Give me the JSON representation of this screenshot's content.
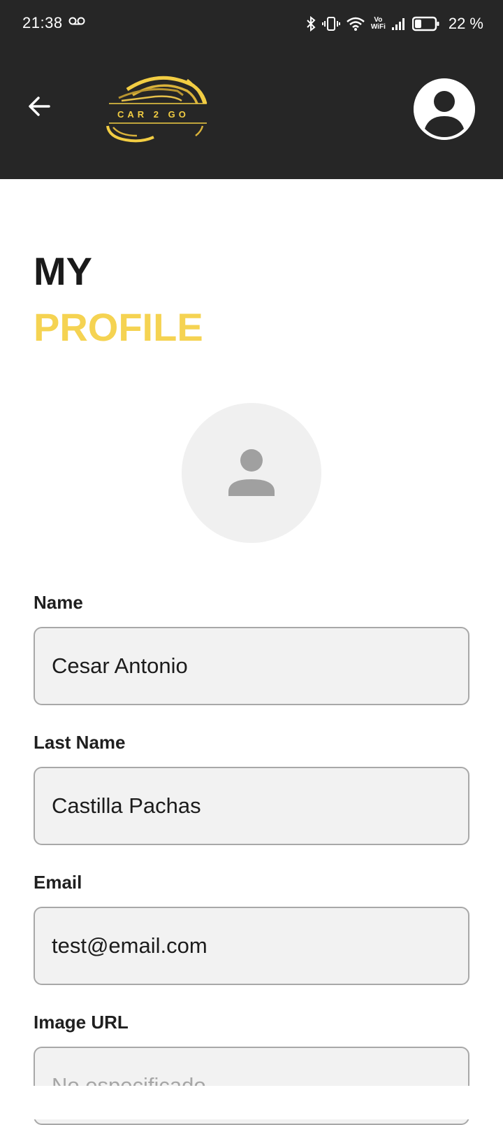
{
  "status_bar": {
    "time": "21:38",
    "vowifi_top": "Vo",
    "vowifi_bottom": "WiFi",
    "battery": "22 %"
  },
  "header": {
    "logo_text": "CAR 2 GO",
    "accent_color": "#f5d352",
    "bar_color": "#262626"
  },
  "page": {
    "title_line1": "MY",
    "title_line2": "PROFILE"
  },
  "form": {
    "fields": [
      {
        "label": "Name",
        "value": "Cesar Antonio",
        "placeholder": ""
      },
      {
        "label": "Last Name",
        "value": "Castilla Pachas",
        "placeholder": ""
      },
      {
        "label": "Email",
        "value": "test@email.com",
        "placeholder": ""
      },
      {
        "label": "Image URL",
        "value": "",
        "placeholder": "No especificado"
      }
    ]
  },
  "icons": {
    "back": "arrow-left-icon",
    "account": "account-circle-icon",
    "avatar": "person-icon"
  }
}
